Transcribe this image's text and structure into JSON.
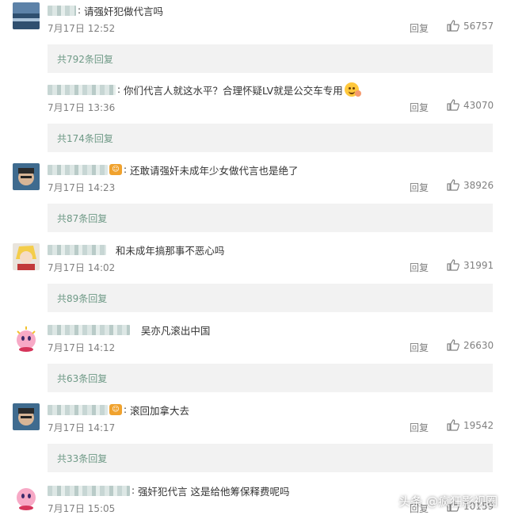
{
  "actions": {
    "reply_label": "回复"
  },
  "comments": [
    {
      "text": "请强奸犯做代言吗",
      "time": "7月17日 12:52",
      "likes": "56757",
      "more": "共792条回复"
    },
    {
      "text": "你们代言人就这水平？合理怀疑LV就是公交车专用",
      "time": "7月17日 13:36",
      "likes": "43070",
      "more": "共174条回复"
    },
    {
      "text": "还敢请强奸未成年少女做代言也是绝了",
      "time": "7月17日 14:23",
      "likes": "38926",
      "more": "共87条回复"
    },
    {
      "text": "和未成年搞那事不恶心吗",
      "time": "7月17日 14:02",
      "likes": "31991",
      "more": "共89条回复"
    },
    {
      "text": "吴亦凡滚出中国",
      "time": "7月17日 14:12",
      "likes": "26630",
      "more": "共63条回复"
    },
    {
      "text": "滚回加拿大去",
      "time": "7月17日 14:17",
      "likes": "19542",
      "more": "共33条回复"
    },
    {
      "text": "强奸犯代言 这是给他筹保释费呢吗",
      "time": "7月17日 15:05",
      "likes": "10159",
      "more": ""
    }
  ],
  "watermark": "头条 @疯狂影视圈",
  "colors": {
    "link": "#6f9a87",
    "meta": "#808080",
    "box": "#f2f2f2"
  }
}
